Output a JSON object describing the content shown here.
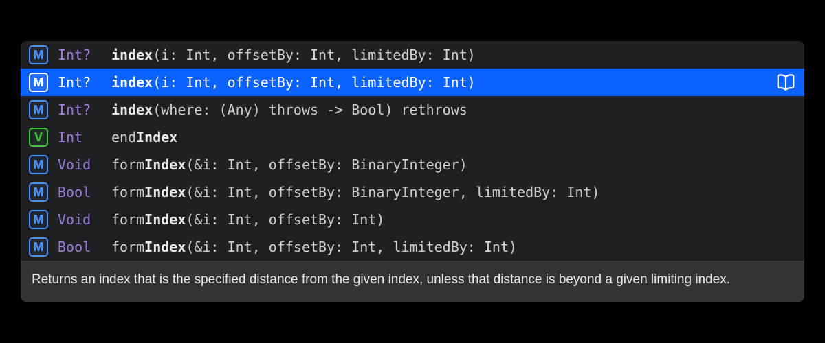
{
  "completions": [
    {
      "kind": "M",
      "kindClass": "method",
      "type": "Int?",
      "pre": "",
      "bold": "index",
      "post": "(i: Int, offsetBy: Int, limitedBy: Int)",
      "selected": false
    },
    {
      "kind": "M",
      "kindClass": "method",
      "type": "Int?",
      "pre": "",
      "bold": "index",
      "post": "(i: Int, offsetBy: Int, limitedBy: Int)",
      "selected": true
    },
    {
      "kind": "M",
      "kindClass": "method",
      "type": "Int?",
      "pre": "",
      "bold": "index",
      "post": "(where: (Any) throws -> Bool) rethrows",
      "selected": false
    },
    {
      "kind": "V",
      "kindClass": "variable",
      "type": "Int",
      "pre": "end",
      "bold": "Index",
      "post": "",
      "selected": false
    },
    {
      "kind": "M",
      "kindClass": "method",
      "type": "Void",
      "pre": "form",
      "bold": "Index",
      "post": "(&i: Int, offsetBy: BinaryInteger)",
      "selected": false
    },
    {
      "kind": "M",
      "kindClass": "method",
      "type": "Bool",
      "pre": "form",
      "bold": "Index",
      "post": "(&i: Int, offsetBy: BinaryInteger, limitedBy: Int)",
      "selected": false
    },
    {
      "kind": "M",
      "kindClass": "method",
      "type": "Void",
      "pre": "form",
      "bold": "Index",
      "post": "(&i: Int, offsetBy: Int)",
      "selected": false
    },
    {
      "kind": "M",
      "kindClass": "method",
      "type": "Bool",
      "pre": "form",
      "bold": "Index",
      "post": "(&i: Int, offsetBy: Int, limitedBy: Int)",
      "selected": false
    }
  ],
  "description": "Returns an index that is the specified distance from the given index, unless that distance is beyond a given limiting index."
}
